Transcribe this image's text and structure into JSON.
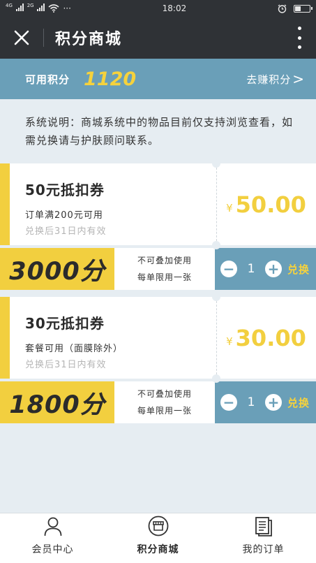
{
  "status_bar": {
    "sim1": "4G",
    "sim2": "2G",
    "extra": "···",
    "time": "18:02",
    "battery_level": 0.35
  },
  "header": {
    "title": "积分商城"
  },
  "points": {
    "label": "可用积分",
    "value": "1120",
    "earn_label": "去赚积分",
    "earn_chevron": ">"
  },
  "notice": {
    "text": "系统说明：商城系统中的物品目前仅支持浏览查看，如需兑换请与护肤顾问联系。"
  },
  "coupons": [
    {
      "title": "50元抵扣券",
      "condition": "订单满200元可用",
      "expiry": "兑换后31日内有效",
      "currency": "¥",
      "price": "50.00",
      "cost": "3000分",
      "rule1": "不可叠加使用",
      "rule2": "每单限用一张",
      "minus": "−",
      "qty": "1",
      "plus": "+",
      "redeem": "兑换"
    },
    {
      "title": "30元抵扣券",
      "condition": "套餐可用（面膜除外）",
      "expiry": "兑换后31日内有效",
      "currency": "¥",
      "price": "30.00",
      "cost": "1800分",
      "rule1": "不可叠加使用",
      "rule2": "每单限用一张",
      "minus": "−",
      "qty": "1",
      "plus": "+",
      "redeem": "兑换"
    }
  ],
  "tabs": [
    {
      "label": "会员中心",
      "icon": "person-icon"
    },
    {
      "label": "积分商城",
      "icon": "shop-icon"
    },
    {
      "label": "我的订单",
      "icon": "document-icon"
    }
  ],
  "colors": {
    "dark_header": "#2f3236",
    "accent_blue": "#6a9fb8",
    "accent_yellow": "#f2cf3f",
    "background": "#e6edf2"
  }
}
